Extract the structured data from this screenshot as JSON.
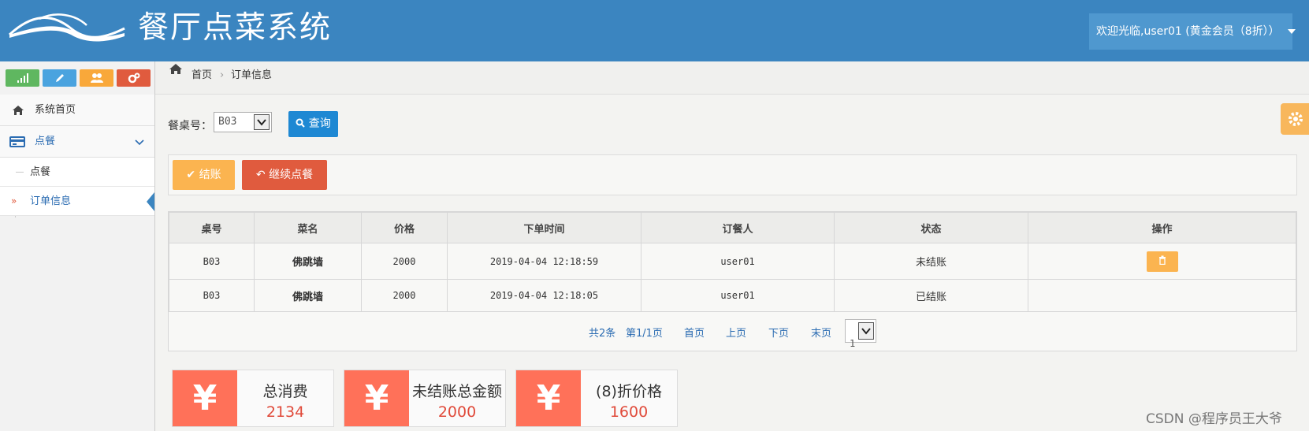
{
  "header": {
    "title": "餐厅点菜系统",
    "user_menu": "欢迎光临,user01 (黄金会员（8折））"
  },
  "sidebar": {
    "items": [
      {
        "label": "系统首页"
      },
      {
        "label": "点餐"
      }
    ],
    "subitems": [
      {
        "label": "点餐"
      },
      {
        "label": "订单信息"
      }
    ]
  },
  "breadcrumb": {
    "home": "首页",
    "current": "订单信息"
  },
  "filter": {
    "label": "餐桌号：",
    "table_value": "B03",
    "query_label": "查询"
  },
  "actions": {
    "checkout_label": "结账",
    "continue_label": "继续点餐"
  },
  "table": {
    "headers": [
      "桌号",
      "菜名",
      "价格",
      "下单时间",
      "订餐人",
      "状态",
      "操作"
    ],
    "rows": [
      {
        "table_no": "B03",
        "dish": "佛跳墙",
        "price": "2000",
        "time": "2019-04-04 12:18:59",
        "orderer": "user01",
        "status": "未结账"
      },
      {
        "table_no": "B03",
        "dish": "佛跳墙",
        "price": "2000",
        "time": "2019-04-04 12:18:05",
        "orderer": "user01",
        "status": "已结账"
      }
    ]
  },
  "pager": {
    "total": "共2条",
    "page_info": "第1/1页",
    "first": "首页",
    "prev": "上页",
    "next": "下页",
    "last": "末页",
    "current_page": "1"
  },
  "cards": [
    {
      "icon": "¥",
      "title": "总消费",
      "value": "2134"
    },
    {
      "icon": "¥",
      "title": "未结账总金额",
      "value": "2000"
    },
    {
      "icon": "¥",
      "title": "(8)折价格",
      "value": "1600"
    }
  ],
  "watermark": "CSDN @程序员王大爷",
  "colors": {
    "header": "#3b85c0",
    "accent_blue": "#1e88d3",
    "warning": "#fbb450",
    "danger": "#e05b3e",
    "card_icon": "#ff7159"
  }
}
